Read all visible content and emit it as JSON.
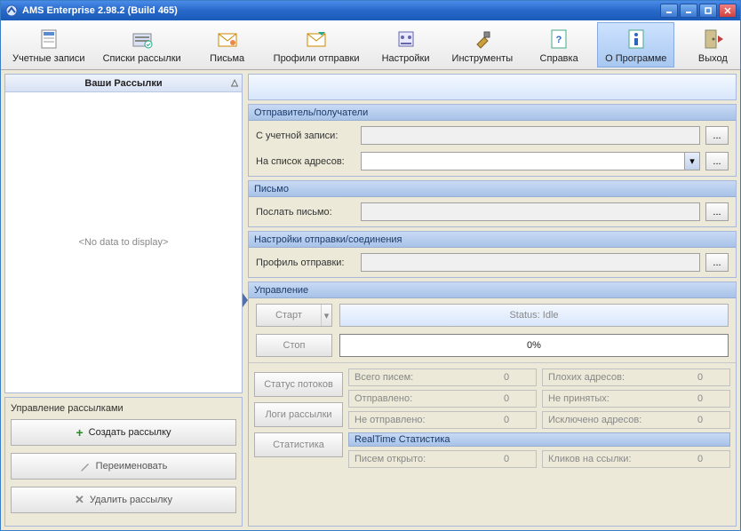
{
  "window": {
    "title": "AMS Enterprise 2.98.2 (Build 465)"
  },
  "toolbar": [
    {
      "id": "accounts",
      "label": "Учетные записи"
    },
    {
      "id": "lists",
      "label": "Списки рассылки"
    },
    {
      "id": "letters",
      "label": "Письма"
    },
    {
      "id": "profiles",
      "label": "Профили отправки"
    },
    {
      "id": "settings",
      "label": "Настройки"
    },
    {
      "id": "tools",
      "label": "Инструменты"
    },
    {
      "id": "help",
      "label": "Справка"
    },
    {
      "id": "about",
      "label": "О Программе",
      "active": true
    },
    {
      "id": "exit",
      "label": "Выход"
    }
  ],
  "left": {
    "panel_title": "Ваши Рассылки",
    "empty_text": "<No data to display>",
    "manage_title": "Управление рассылками",
    "create": "Создать рассылку",
    "rename": "Переименовать",
    "delete": "Удалить рассылку"
  },
  "sections": {
    "sender": {
      "title": "Отправитель/получатели",
      "from_account": "С учетной записи:",
      "to_list": "На список адресов:"
    },
    "letter": {
      "title": "Письмо",
      "send_letter": "Послать письмо:"
    },
    "sending": {
      "title": "Настройки отправки/соединения",
      "profile": "Профиль отправки:"
    },
    "control": {
      "title": "Управление",
      "start": "Старт",
      "stop": "Стоп",
      "status": "Status: Idle",
      "progress": "0%"
    }
  },
  "stats": {
    "btn_threads": "Статус потоков",
    "btn_logs": "Логи рассылки",
    "btn_stats": "Статистика",
    "rows": [
      {
        "l": "Всего писем:",
        "lv": "0",
        "r": "Плохих адресов:",
        "rv": "0"
      },
      {
        "l": "Отправлено:",
        "lv": "0",
        "r": "Не принятых:",
        "rv": "0"
      },
      {
        "l": "Не отправлено:",
        "lv": "0",
        "r": "Исключено адресов:",
        "rv": "0"
      }
    ],
    "rt_title": "RealTime Статистика",
    "rt": {
      "l": "Писем открыто:",
      "lv": "0",
      "r": "Кликов на ссылки:",
      "rv": "0"
    }
  }
}
